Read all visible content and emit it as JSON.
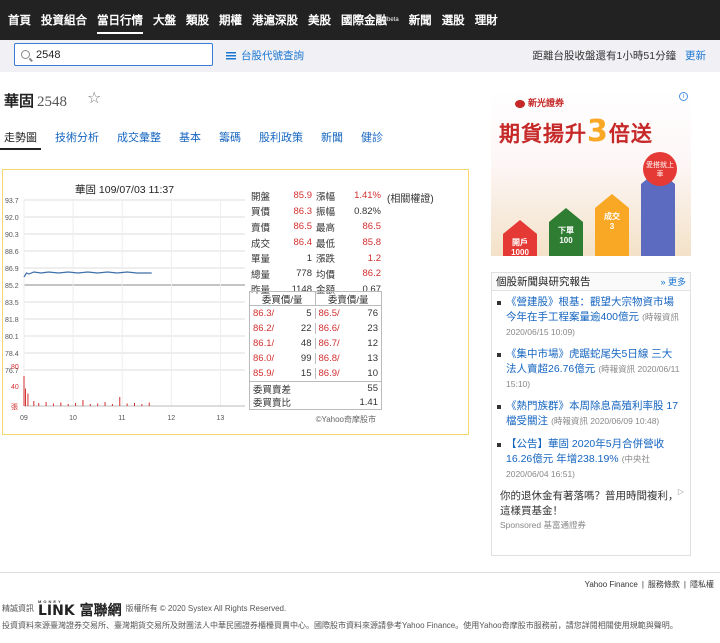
{
  "nav": {
    "items": [
      "首頁",
      "投資組合",
      "當日行情",
      "大盤",
      "類股",
      "期權",
      "港滬深股",
      "美股",
      "國際金融",
      "新聞",
      "選股",
      "理財"
    ],
    "active_index": 2,
    "beta_tag": "beta"
  },
  "search": {
    "value": "2548",
    "code_query_label": "台股代號查詢",
    "close_info": "距離台股收盤還有1小時51分鐘",
    "refresh_label": "更新"
  },
  "stock": {
    "name": "華固",
    "code": "2548"
  },
  "tabs": [
    "走勢圖",
    "技術分析",
    "成交彙整",
    "基本",
    "籌碼",
    "股利政策",
    "新聞",
    "健診"
  ],
  "quote": {
    "chart_title": "華固 109/07/03 11:37",
    "adjusted_note": "(相關權證)",
    "rows": [
      {
        "l1": "開盤",
        "v1": "85.9",
        "l2": "漲幅",
        "v2": "1.41%"
      },
      {
        "l1": "買價",
        "v1": "86.3",
        "l2": "振幅",
        "v2": "0.82%"
      },
      {
        "l1": "賣價",
        "v1": "86.5",
        "l2": "最高",
        "v2": "86.5"
      },
      {
        "l1": "成交",
        "v1": "86.4",
        "l2": "最低",
        "v2": "85.8"
      },
      {
        "l1": "單量",
        "v1": "1",
        "l2": "漲跌",
        "v2": "1.2"
      },
      {
        "l1": "總量",
        "v1": "778",
        "l2": "均價",
        "v2": "86.2"
      },
      {
        "l1": "昨量",
        "v1": "1148",
        "l2": "金額",
        "v2": "0.67"
      }
    ],
    "orderbook": {
      "bid_header": "委買價/量",
      "ask_header": "委賣價/量",
      "rows": [
        {
          "bp": "86.3/",
          "bq": "5",
          "ap": "86.5/",
          "aq": "76"
        },
        {
          "bp": "86.2/",
          "bq": "22",
          "ap": "86.6/",
          "aq": "23"
        },
        {
          "bp": "86.1/",
          "bq": "48",
          "ap": "86.7/",
          "aq": "12"
        },
        {
          "bp": "86.0/",
          "bq": "99",
          "ap": "86.8/",
          "aq": "13"
        },
        {
          "bp": "85.9/",
          "bq": "15",
          "ap": "86.9/",
          "aq": "10"
        }
      ],
      "diff_label": "委買賣差",
      "diff_value": "55",
      "ratio_label": "委買賣比",
      "ratio_value": "1.41"
    },
    "copyright": "©Yahoo奇摩股市"
  },
  "chart_data": {
    "type": "line",
    "title": "華固 109/07/03 11:37",
    "y_ticks": [
      "93.7",
      "92.0",
      "90.3",
      "88.6",
      "86.9",
      "85.2",
      "83.5",
      "81.8",
      "80.1",
      "78.4",
      "76.7"
    ],
    "ylim": [
      76.7,
      93.7
    ],
    "ref_price": 85.2,
    "x_ticks": [
      "09",
      "10",
      "11",
      "12",
      "13"
    ],
    "price_series": [
      {
        "t": 9.0,
        "p": 86.0
      },
      {
        "t": 9.05,
        "p": 86.4
      },
      {
        "t": 9.1,
        "p": 86.3
      },
      {
        "t": 9.2,
        "p": 86.5
      },
      {
        "t": 9.35,
        "p": 86.4
      },
      {
        "t": 9.5,
        "p": 86.5
      },
      {
        "t": 9.7,
        "p": 86.4
      },
      {
        "t": 9.9,
        "p": 86.5
      },
      {
        "t": 10.1,
        "p": 86.4
      },
      {
        "t": 10.3,
        "p": 86.5
      },
      {
        "t": 10.5,
        "p": 86.4
      },
      {
        "t": 10.7,
        "p": 86.5
      },
      {
        "t": 10.9,
        "p": 86.4
      },
      {
        "t": 11.1,
        "p": 86.5
      },
      {
        "t": 11.3,
        "p": 86.4
      },
      {
        "t": 11.6,
        "p": 86.4
      }
    ],
    "volume_ticks": [
      "80",
      "40",
      "張"
    ],
    "volume_max": 80,
    "volume": [
      {
        "t": 9.0,
        "v": 60
      },
      {
        "t": 9.03,
        "v": 35
      },
      {
        "t": 9.08,
        "v": 25
      },
      {
        "t": 9.2,
        "v": 10
      },
      {
        "t": 9.3,
        "v": 6
      },
      {
        "t": 9.45,
        "v": 8
      },
      {
        "t": 9.6,
        "v": 5
      },
      {
        "t": 9.75,
        "v": 7
      },
      {
        "t": 9.9,
        "v": 4
      },
      {
        "t": 10.05,
        "v": 6
      },
      {
        "t": 10.2,
        "v": 12
      },
      {
        "t": 10.35,
        "v": 4
      },
      {
        "t": 10.5,
        "v": 5
      },
      {
        "t": 10.65,
        "v": 8
      },
      {
        "t": 10.8,
        "v": 4
      },
      {
        "t": 10.95,
        "v": 18
      },
      {
        "t": 11.1,
        "v": 5
      },
      {
        "t": 11.25,
        "v": 6
      },
      {
        "t": 11.4,
        "v": 4
      },
      {
        "t": 11.55,
        "v": 7
      }
    ]
  },
  "ad": {
    "brand": "新光證券",
    "headline_a": "期貨揚升",
    "headline_b": "3",
    "headline_c": "倍送",
    "houses": [
      "開戶",
      "下單",
      "成交",
      ""
    ],
    "house_sub": [
      "1000",
      "100",
      "3",
      ""
    ],
    "badge": "愛搭就上車"
  },
  "news": {
    "title": "個股新聞與研究報告",
    "more": "» 更多",
    "items": [
      {
        "title": "《營建股》根基：觀望大宗物資市場 今年在手工程案量逾400億元",
        "source": "(時報資訊",
        "date": "2020/06/15 10:09)"
      },
      {
        "title": "《集中市場》虎踞蛇尾失5日線 三大法人賣超26.76億元",
        "source": "(時報資訊 2020/06/11",
        "date": "15:10)"
      },
      {
        "title": "《熱門族群》本周除息高殖利率股 17檔受關注",
        "source": "(時報資訊 2020/06/09 10:48)",
        "date": ""
      },
      {
        "title": "【公告】華固 2020年5月合併營收16.26億元 年增238.19%",
        "source": "(中央社",
        "date": "2020/06/04 16:51)"
      }
    ],
    "sponsor_title": "你的退休金有著落嗎？普用時間複利，這樣買基金！",
    "sponsor_label": "Sponsored  基富通證券",
    "sponsor_icon": "▷"
  },
  "footer": {
    "links": [
      "Yahoo Finance",
      "服務條款",
      "隱私權"
    ],
    "provider_label": "精誠資訊",
    "logo_small": "MONEY",
    "logo_big": "LINK 富聯網",
    "copyright": "版權所有 © 2020 Systex All Rights Reserved.",
    "sources": "投資資料來源臺灣證券交易所、臺灣期貨交易所及財團法人中華民國證券櫃檯買賣中心。國際股市資料來源請參考Yahoo Finance。使用Yahoo奇摩股市服務前，請您詳閱相關使用規範與聲明。"
  }
}
